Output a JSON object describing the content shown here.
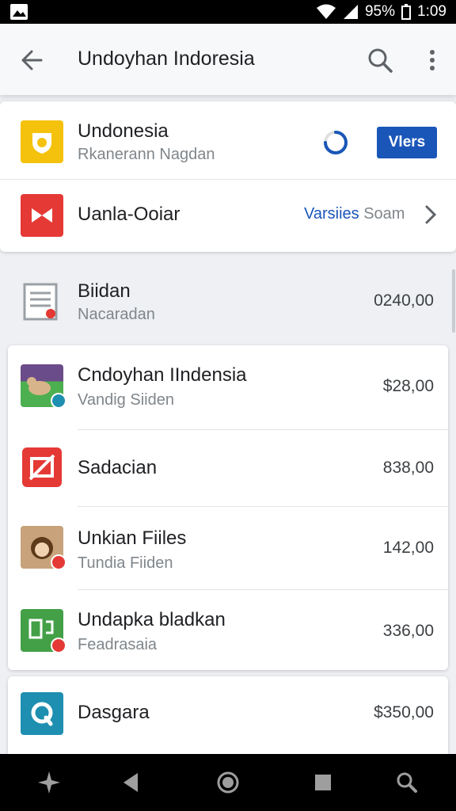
{
  "status_bar": {
    "battery": "95%",
    "time": "1:09"
  },
  "app_bar": {
    "title": "Undoyhan Indoresia"
  },
  "top_card": {
    "row1": {
      "title": "Undonesia",
      "subtitle": "Rkanerann Nagdan",
      "button": "Vlers",
      "icon_color": "#f4c20d"
    },
    "row2": {
      "title": "Uanla-Ooiar",
      "link_primary": "Varsiies",
      "link_secondary": "Soam",
      "icon_color": "#e53935"
    }
  },
  "section": {
    "title": "Biidan",
    "subtitle": "Nacaradan",
    "price": "0240,00"
  },
  "list": [
    {
      "title": "Cndoyhan IIndensia",
      "subtitle": "Vandig Siiden",
      "price": "$28,00"
    },
    {
      "title": "Sadacian",
      "subtitle": "",
      "price": "838,00"
    },
    {
      "title": "Unkian Fiiles",
      "subtitle": "Tundia Fiiden",
      "price": "142,00"
    },
    {
      "title": "Undapka bladkan",
      "subtitle": "Feadrasaia",
      "price": "336,00"
    }
  ],
  "last_item": {
    "title": "Dasgara",
    "price": "$350,00"
  },
  "colors": {
    "accent": "#1a56b8",
    "red": "#e53935",
    "green": "#43a047",
    "teal": "#1e8fb0",
    "yellow": "#f4c20d"
  }
}
